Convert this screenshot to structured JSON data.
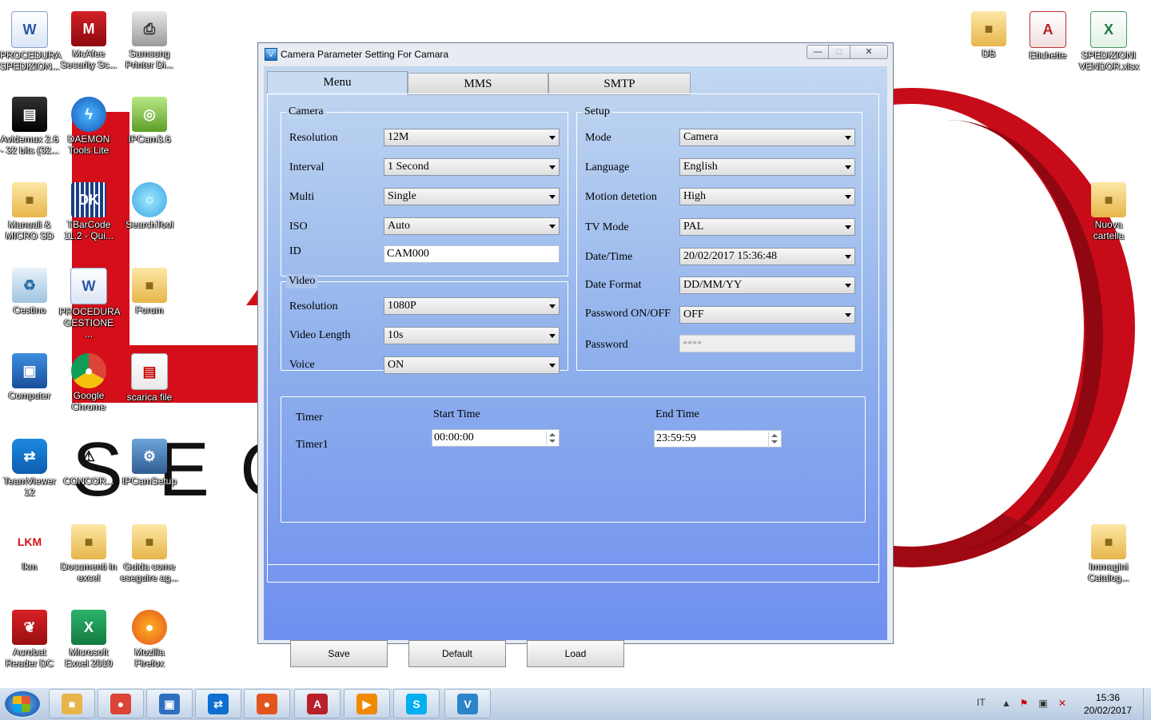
{
  "window": {
    "title": "Camera Parameter Setting For  Camara",
    "min_label": "—",
    "max_label": "□",
    "close_label": "✕"
  },
  "tabs": [
    {
      "label": "Menu",
      "active": true
    },
    {
      "label": "MMS",
      "active": false
    },
    {
      "label": "SMTP",
      "active": false
    }
  ],
  "camera_group": {
    "legend": "Camera",
    "resolution": {
      "label": "Resolution",
      "value": "12M"
    },
    "interval": {
      "label": "Interval",
      "value": "1 Second"
    },
    "multi": {
      "label": "Multi",
      "value": "Single"
    },
    "iso": {
      "label": "ISO",
      "value": "Auto"
    },
    "id": {
      "label": "ID",
      "value": "CAM000"
    }
  },
  "video_group": {
    "legend": "Video",
    "resolution": {
      "label": "Resolution",
      "value": "1080P"
    },
    "length": {
      "label": "Video Length",
      "value": "10s"
    },
    "voice": {
      "label": "Voice",
      "value": "ON"
    }
  },
  "setup_group": {
    "legend": "Setup",
    "mode": {
      "label": "Mode",
      "value": "Camera"
    },
    "language": {
      "label": "Language",
      "value": "English"
    },
    "motion": {
      "label": "Motion detetion",
      "value": "High"
    },
    "tv_mode": {
      "label": "TV Mode",
      "value": "PAL"
    },
    "datetime": {
      "label": "Date/Time",
      "value": "20/02/2017 15:36:48"
    },
    "date_format": {
      "label": "Date Format",
      "value": "DD/MM/YY"
    },
    "password_onoff": {
      "label": "Password ON/OFF",
      "value": "OFF"
    },
    "password": {
      "label": "Password",
      "value": "****"
    }
  },
  "timer_group": {
    "title": "Timer",
    "start_header": "Start Time",
    "end_header": "End Time",
    "row_label": "Timer1",
    "start_value": "00:00:00",
    "end_value": "23:59:59"
  },
  "buttons": {
    "save": "Save",
    "default": "Default",
    "load": "Load"
  },
  "desktop_icons": [
    {
      "label": "PROCEDURA SPEDIZION...",
      "icon": "word-doc-icon",
      "glyph": "W",
      "cls": "g-word",
      "shortcut": false
    },
    {
      "label": "McAfee Security Sc...",
      "icon": "mcafee-shield-icon",
      "glyph": "M",
      "cls": "g-shield",
      "shortcut": true
    },
    {
      "label": "Samsung Printer Di...",
      "icon": "printer-icon",
      "glyph": "⎙",
      "cls": "g-printer",
      "shortcut": true
    },
    {
      "label": "Avidemux 2.6 - 32 bits (32...",
      "icon": "clapperboard-icon",
      "glyph": "▤",
      "cls": "g-clap",
      "shortcut": true
    },
    {
      "label": "DAEMON Tools Lite",
      "icon": "daemon-lightning-icon",
      "glyph": "ϟ",
      "cls": "g-daemon",
      "shortcut": true
    },
    {
      "label": "IPCam3.6",
      "icon": "magnifier-icon",
      "glyph": "◎",
      "cls": "g-mag",
      "shortcut": false
    },
    {
      "label": "Manuali & MICRO SD",
      "icon": "folder-icon",
      "glyph": "■",
      "cls": "g-folder",
      "shortcut": false
    },
    {
      "label": "TBarCode 11.2 - Qui...",
      "icon": "qr-code-icon",
      "glyph": "DK",
      "cls": "g-qr",
      "shortcut": true
    },
    {
      "label": "SearchTool",
      "icon": "search-camera-icon",
      "glyph": "○",
      "cls": "g-search",
      "shortcut": false
    },
    {
      "label": "Cestino",
      "icon": "recycle-bin-icon",
      "glyph": "♻",
      "cls": "g-bin",
      "shortcut": false
    },
    {
      "label": "PROCEDURA GESTIONE ...",
      "icon": "word-doc-icon",
      "glyph": "W",
      "cls": "g-word",
      "shortcut": false
    },
    {
      "label": "Forum",
      "icon": "folder-icon",
      "glyph": "■",
      "cls": "g-folder",
      "shortcut": false
    },
    {
      "label": "Computer",
      "icon": "computer-icon",
      "glyph": "▣",
      "cls": "g-pc",
      "shortcut": true
    },
    {
      "label": "Google Chrome",
      "icon": "chrome-icon",
      "glyph": "●",
      "cls": "g-chrome",
      "shortcut": true
    },
    {
      "label": "scarica file",
      "icon": "document-icon",
      "glyph": "▤",
      "cls": "g-doc",
      "shortcut": false
    },
    {
      "label": "TeamViewer 12",
      "icon": "teamviewer-icon",
      "glyph": "⇄",
      "cls": "g-tv",
      "shortcut": true
    },
    {
      "label": "CONCOR...",
      "icon": "warning-icon",
      "glyph": "⚠",
      "cls": "g-warn",
      "shortcut": true
    },
    {
      "label": "IPCamSetup",
      "icon": "setup-icon",
      "glyph": "⚙",
      "cls": "g-setup",
      "shortcut": true
    },
    {
      "label": "lkm",
      "icon": "lkm-logo-icon",
      "glyph": "LKM",
      "cls": "g-lkm",
      "shortcut": false
    },
    {
      "label": "Documenti in excel",
      "icon": "folder-icon",
      "glyph": "■",
      "cls": "g-folder",
      "shortcut": false
    },
    {
      "label": "Guida come eseguire ag...",
      "icon": "folder-icon",
      "glyph": "■",
      "cls": "g-folder",
      "shortcut": false
    },
    {
      "label": "Acrobat Reader DC",
      "icon": "acrobat-icon",
      "glyph": "❦",
      "cls": "g-acro",
      "shortcut": true
    },
    {
      "label": "Microsoft Excel 2010",
      "icon": "excel-icon",
      "glyph": "X",
      "cls": "g-excel",
      "shortcut": true
    },
    {
      "label": "Mozilla Firefox",
      "icon": "firefox-icon",
      "glyph": "●",
      "cls": "g-ff",
      "shortcut": true
    },
    {
      "label": "DB",
      "icon": "folder-icon",
      "glyph": "■",
      "cls": "g-folder",
      "shortcut": true
    },
    {
      "label": "Etichette",
      "icon": "access-db-icon",
      "glyph": "A",
      "cls": "g-access",
      "shortcut": true
    },
    {
      "label": "SPEDIZIONI VENDOR.xlsx",
      "icon": "excel-file-icon",
      "glyph": "X",
      "cls": "g-xls",
      "shortcut": true
    },
    {
      "label": "Nuova cartella",
      "icon": "folder-icon",
      "glyph": "■",
      "cls": "g-folder",
      "shortcut": false
    },
    {
      "label": "Immagini Catalog...",
      "icon": "folder-icon",
      "glyph": "■",
      "cls": "g-folder",
      "shortcut": true
    }
  ],
  "taskbar": {
    "apps": [
      {
        "icon": "explorer-folder-icon",
        "glyph": "■",
        "color": "#e7b54a"
      },
      {
        "icon": "chrome-icon",
        "glyph": "●",
        "color": "#db4437"
      },
      {
        "icon": "network-computer-icon",
        "glyph": "▣",
        "color": "#2f6fbf"
      },
      {
        "icon": "teamviewer-icon",
        "glyph": "⇄",
        "color": "#0d6fd0"
      },
      {
        "icon": "firefox-icon",
        "glyph": "●",
        "color": "#e2561e"
      },
      {
        "icon": "access-icon",
        "glyph": "A",
        "color": "#b81f2a"
      },
      {
        "icon": "media-player-icon",
        "glyph": "▶",
        "color": "#f08a00"
      },
      {
        "icon": "skype-icon",
        "glyph": "S",
        "color": "#00aff0"
      },
      {
        "icon": "camera-setting-app-icon",
        "glyph": "V",
        "color": "#2a86c9"
      }
    ],
    "language": "IT",
    "time": "15:36",
    "date": "20/02/2017"
  },
  "wallpaper_letters": {
    "s": "S",
    "e": "E",
    "c": "C"
  }
}
